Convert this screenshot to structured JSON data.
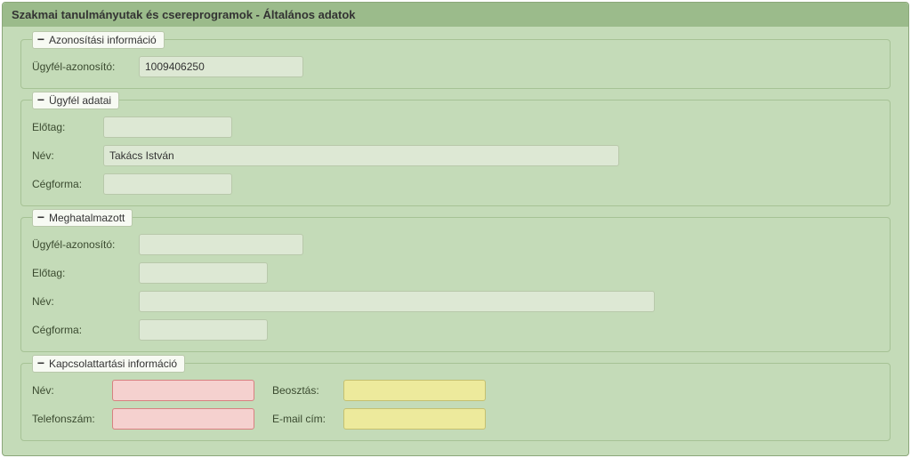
{
  "title": "Szakmai tanulmányutak és csereprogramok - Általános adatok",
  "section_identification": {
    "legend": "Azonosítási információ",
    "client_id_label": "Ügyfél-azonosító:",
    "client_id_value": "1009406250"
  },
  "section_client": {
    "legend": "Ügyfél adatai",
    "prefix_label": "Előtag:",
    "prefix_value": "",
    "name_label": "Név:",
    "name_value": "Takács István",
    "company_form_label": "Cégforma:",
    "company_form_value": ""
  },
  "section_delegate": {
    "legend": "Meghatalmazott",
    "client_id_label": "Ügyfél-azonosító:",
    "client_id_value": "",
    "prefix_label": "Előtag:",
    "prefix_value": "",
    "name_label": "Név:",
    "name_value": "",
    "company_form_label": "Cégforma:",
    "company_form_value": ""
  },
  "section_contact": {
    "legend": "Kapcsolattartási információ",
    "name_label": "Név:",
    "name_value": "",
    "position_label": "Beosztás:",
    "position_value": "",
    "phone_label": "Telefonszám:",
    "phone_value": "",
    "email_label": "E-mail cím:",
    "email_value": ""
  },
  "collapse_icon": "−"
}
